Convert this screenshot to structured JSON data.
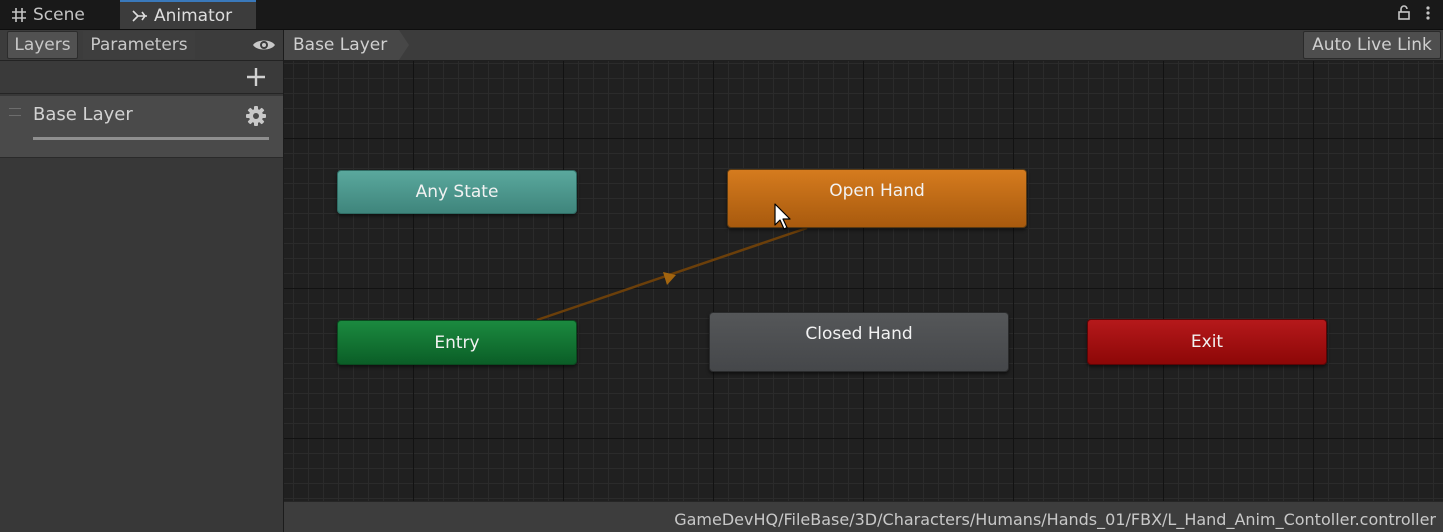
{
  "tabs": [
    {
      "label": "Scene",
      "icon": "grid-icon",
      "active": false
    },
    {
      "label": "Animator",
      "icon": "animator-icon",
      "active": true
    }
  ],
  "window_icons": [
    "lock-icon",
    "more-menu-icon"
  ],
  "left_panel": {
    "tabs": [
      {
        "label": "Layers",
        "active": true
      },
      {
        "label": "Parameters",
        "active": false
      }
    ],
    "eye_icon": "eye-icon",
    "add_icon": "plus-icon",
    "layers": [
      {
        "name": "Base Layer",
        "icon": "gear-icon"
      }
    ]
  },
  "breadcrumb": {
    "items": [
      "Base Layer"
    ],
    "auto_live_link": "Auto Live Link"
  },
  "graph": {
    "states": {
      "any_state": "Any State",
      "open_hand": "Open Hand",
      "entry": "Entry",
      "closed_hand": "Closed Hand",
      "exit": "Exit"
    },
    "transitions": [
      {
        "from": "Entry",
        "to": "Open Hand"
      }
    ],
    "colors": {
      "any_state": "#4a9a8f",
      "open_hand": "#c86e14",
      "entry": "#137a34",
      "closed_hand": "#4d4f52",
      "exit": "#a30f10",
      "transition": "#6b3f0a",
      "tab_accent": "#3a79bb"
    }
  },
  "status_bar": {
    "path": "GameDevHQ/FileBase/3D/Characters/Humans/Hands_01/FBX/L_Hand_Anim_Contoller.controller"
  }
}
